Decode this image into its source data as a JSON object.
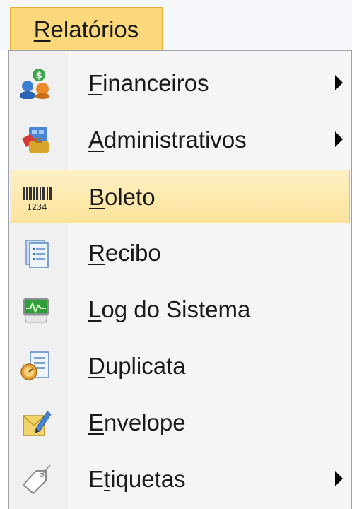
{
  "menu": {
    "title": "Relatórios",
    "title_mnemonic": "R",
    "title_rest": "elatórios"
  },
  "items": [
    {
      "mn": "F",
      "rest": "inanceiros",
      "icon": "money-users-icon",
      "submenu": true
    },
    {
      "mn": "A",
      "rest": "dministrativos",
      "icon": "admin-briefcase-icon",
      "submenu": true
    },
    {
      "mn": "B",
      "rest": "oleto",
      "icon": "barcode-icon",
      "submenu": false,
      "highlighted": true
    },
    {
      "mn": "R",
      "rest": "ecibo",
      "icon": "receipt-document-icon",
      "submenu": false
    },
    {
      "mn": "L",
      "rest": "og do Sistema",
      "icon": "system-log-monitor-icon",
      "submenu": false
    },
    {
      "mn": "D",
      "rest": "uplicata",
      "icon": "duplicate-document-icon",
      "submenu": false
    },
    {
      "mn": "E",
      "rest": "nvelope",
      "icon": "envelope-edit-icon",
      "submenu": false
    },
    {
      "pre": "E",
      "mn": "t",
      "rest": "iquetas",
      "icon": "tag-label-icon",
      "submenu": true
    }
  ],
  "colors": {
    "highlight": "#fbe39b",
    "title_background": "#fbd97a",
    "panel_background": "#f5f5f5"
  }
}
